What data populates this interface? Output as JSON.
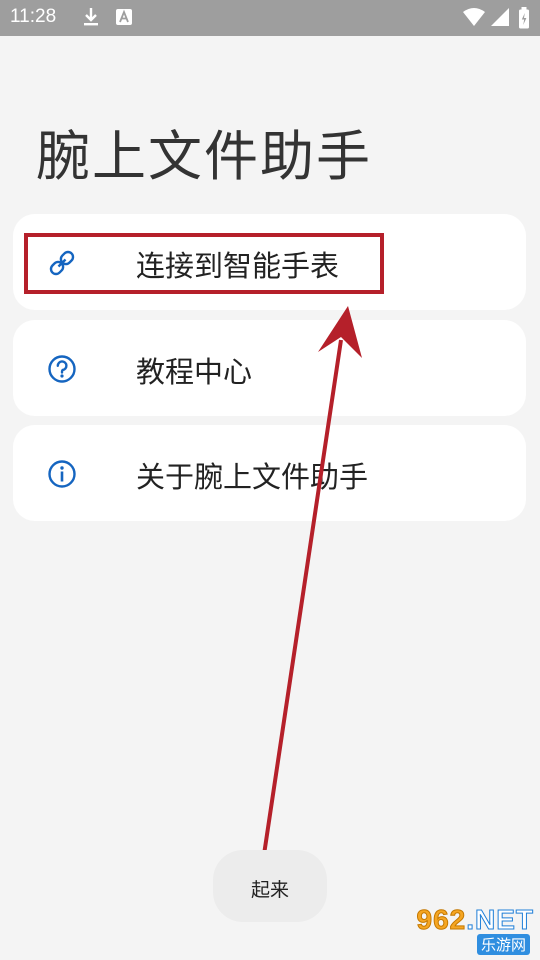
{
  "status_bar": {
    "time": "11:28",
    "icons": [
      "download-icon",
      "a-notification-icon",
      "wifi-icon",
      "signal-icon",
      "battery-icon"
    ]
  },
  "app": {
    "title": "腕上文件助手"
  },
  "menu": {
    "items": [
      {
        "icon": "link-icon",
        "label": "连接到智能手表"
      },
      {
        "icon": "question-circle-icon",
        "label": "教程中心"
      },
      {
        "icon": "info-circle-icon",
        "label": "关于腕上文件助手"
      }
    ]
  },
  "bottom_button": {
    "label": "起来"
  },
  "watermark": {
    "main_prefix": "962",
    "main_suffix": ".NET",
    "sub": "乐游网"
  },
  "colors": {
    "accent": "#1565c0",
    "annotation": "#b5202a",
    "background": "#f4f4f4",
    "card": "#ffffff"
  }
}
